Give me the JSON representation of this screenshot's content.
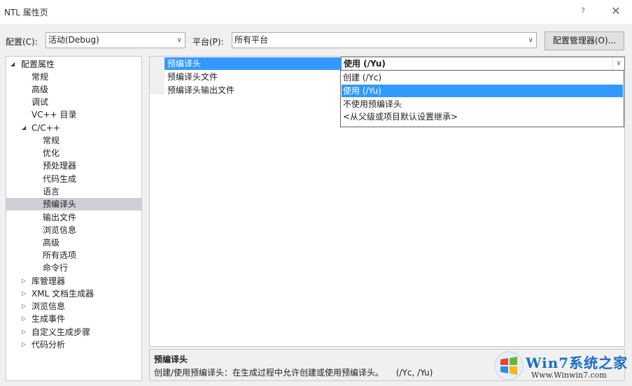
{
  "window": {
    "title": "NTL 属性页",
    "help": "?",
    "close": "✕"
  },
  "toolbar": {
    "config_label": "配置(C):",
    "config_value": "活动(Debug)",
    "platform_label": "平台(P):",
    "platform_value": "所有平台",
    "manager_button": "配置管理器(O)..."
  },
  "tree": {
    "root": "配置属性",
    "general": "常规",
    "advanced": "高级",
    "debugging": "调试",
    "vc_dirs": "VC++ 目录",
    "cpp": "C/C++",
    "cpp_children": [
      "常规",
      "优化",
      "预处理器",
      "代码生成",
      "语言",
      "预编译头",
      "输出文件",
      "浏览信息",
      "高级",
      "所有选项",
      "命令行"
    ],
    "collapsed": [
      "库管理器",
      "XML 文档生成器",
      "浏览信息",
      "生成事件",
      "自定义生成步骤",
      "代码分析"
    ]
  },
  "grid": {
    "rows": [
      "预编译头",
      "预编译头文件",
      "预编译头输出文件"
    ],
    "selected_value": "使用 (/Yu)",
    "options": [
      "创建 (/Yc)",
      "使用 (/Yu)",
      "不使用预编译头",
      "<从父级或项目默认设置继承>"
    ]
  },
  "description": {
    "title": "预编译头",
    "text": "创建/使用预编译头：在生成过程中允许创建或使用预编译头。",
    "switches": "(/Yc, /Yu)"
  },
  "watermark": {
    "brand": "Win7系统之家",
    "url": "Www.Winwin7.com"
  },
  "colors": {
    "selection": "#3399ff",
    "tree_selection": "#cfcfd6",
    "brand": "#1a6fc2"
  }
}
